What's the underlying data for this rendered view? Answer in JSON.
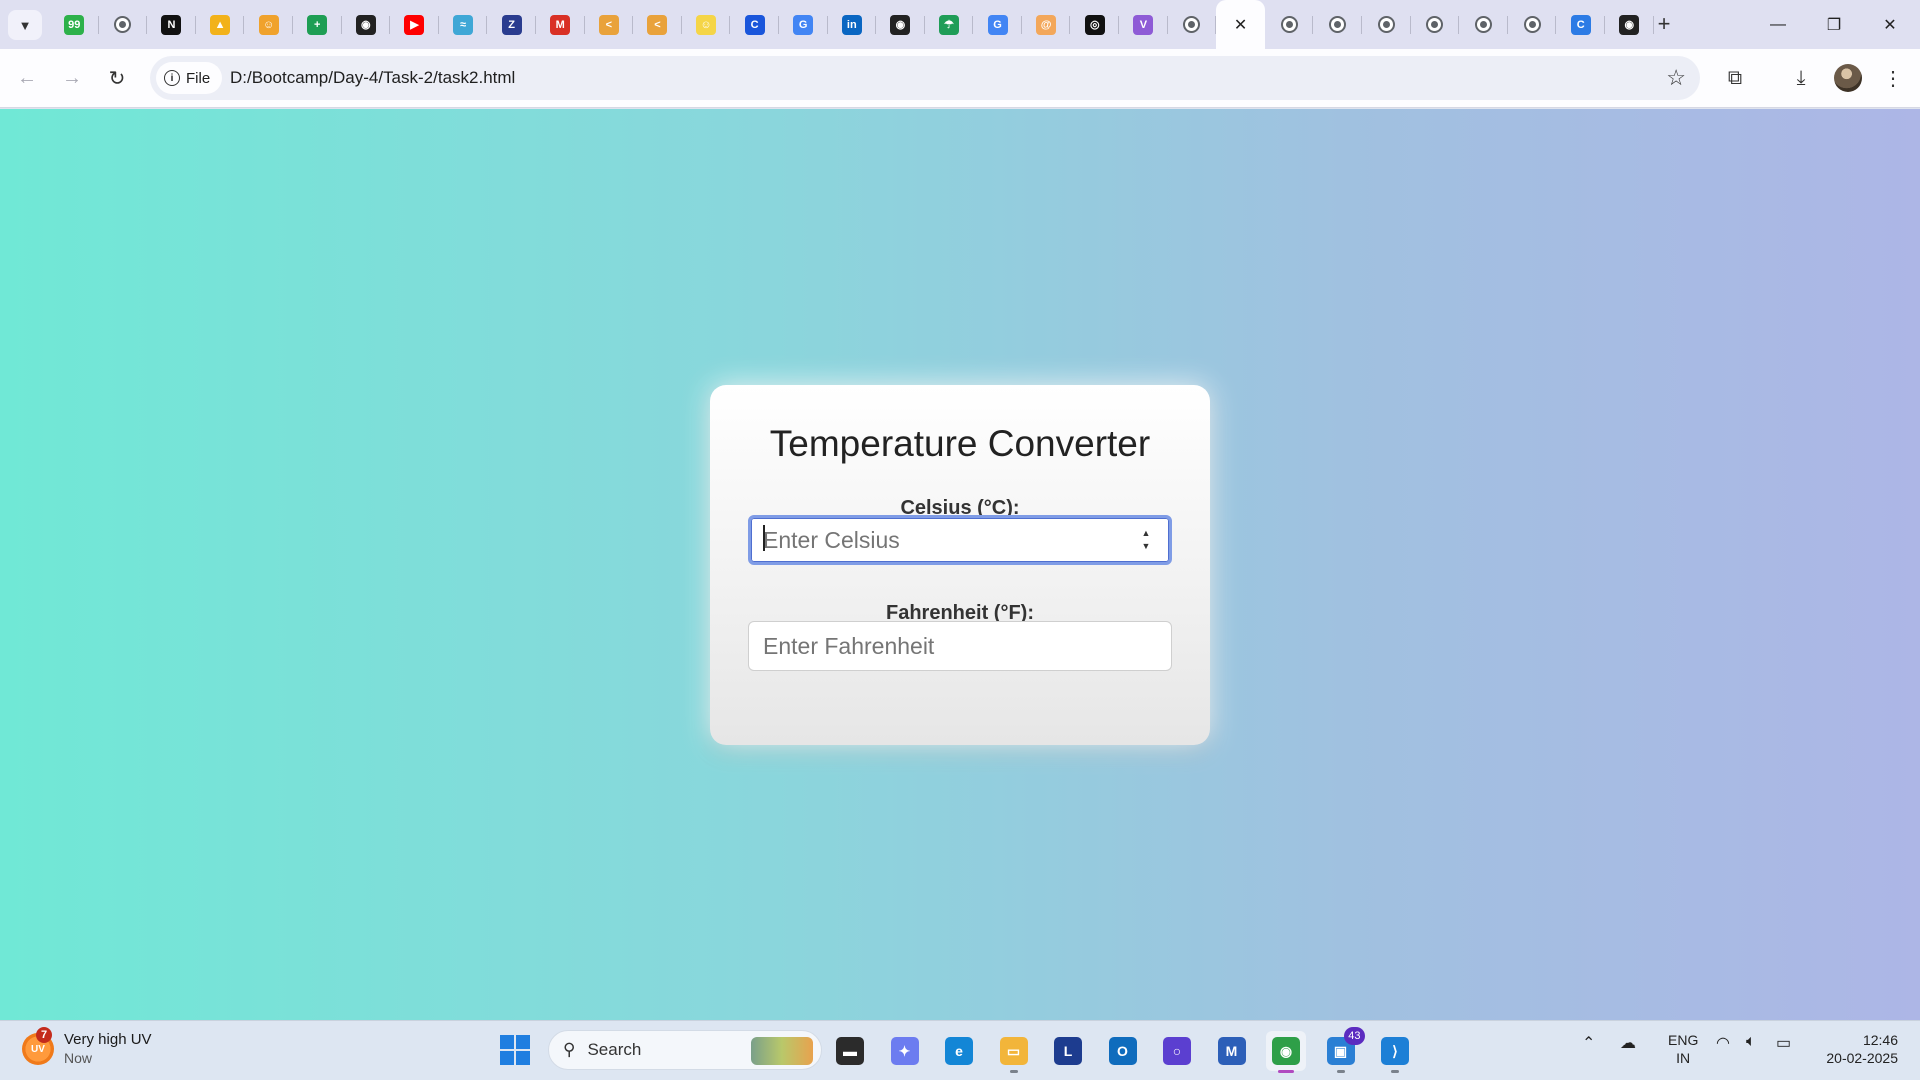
{
  "browser": {
    "pinned_tabs": [
      {
        "icon": "dollar-icon",
        "color": "#2db14a",
        "glyph": "99"
      },
      {
        "icon": "globe-icon",
        "color": "",
        "glyph": ""
      },
      {
        "icon": "notion-icon",
        "color": "#111111",
        "glyph": "N"
      },
      {
        "icon": "drive-icon",
        "color": "#f2b21a",
        "glyph": "▲"
      },
      {
        "icon": "emoji-icon",
        "color": "#f0a22c",
        "glyph": "☺"
      },
      {
        "icon": "sheets-icon",
        "color": "#1e9e54",
        "glyph": "+"
      },
      {
        "icon": "github-icon",
        "color": "#222222",
        "glyph": "◉"
      },
      {
        "icon": "youtube-icon",
        "color": "#ff0000",
        "glyph": "▶"
      },
      {
        "icon": "wave-icon",
        "color": "#3fa7d6",
        "glyph": "≈"
      },
      {
        "icon": "zeo-icon",
        "color": "#2a3c8f",
        "glyph": "Z"
      },
      {
        "icon": "gmail-icon",
        "color": "#d93025",
        "glyph": "M"
      },
      {
        "icon": "chevron-logo-icon",
        "color": "#e9a23b",
        "glyph": "<"
      },
      {
        "icon": "chevron-logo-icon",
        "color": "#e9a23b",
        "glyph": "<"
      },
      {
        "icon": "avatar-icon",
        "color": "#f5d547",
        "glyph": "☺"
      },
      {
        "icon": "c-logo-icon",
        "color": "#1a56db",
        "glyph": "C"
      },
      {
        "icon": "google-icon",
        "color": "#4285f4",
        "glyph": "G"
      },
      {
        "icon": "linkedin-icon",
        "color": "#0a66c2",
        "glyph": "in"
      },
      {
        "icon": "github-icon",
        "color": "#222222",
        "glyph": "◉"
      },
      {
        "icon": "umbrella-icon",
        "color": "#1f9d57",
        "glyph": "☂"
      },
      {
        "icon": "google-icon",
        "color": "#4285f4",
        "glyph": "G"
      },
      {
        "icon": "swirl-icon",
        "color": "#f3a75a",
        "glyph": "@"
      },
      {
        "icon": "openai-icon",
        "color": "#111111",
        "glyph": "◎"
      },
      {
        "icon": "vuetify-icon",
        "color": "#8e5bd6",
        "glyph": "V"
      },
      {
        "icon": "globe-icon",
        "color": "",
        "glyph": ""
      }
    ],
    "trailing_tabs": [
      {
        "icon": "globe-icon",
        "color": "",
        "glyph": ""
      },
      {
        "icon": "globe-icon",
        "color": "",
        "glyph": ""
      },
      {
        "icon": "globe-icon",
        "color": "",
        "glyph": ""
      },
      {
        "icon": "globe-icon",
        "color": "",
        "glyph": ""
      },
      {
        "icon": "globe-icon",
        "color": "",
        "glyph": ""
      },
      {
        "icon": "globe-icon",
        "color": "",
        "glyph": ""
      },
      {
        "icon": "copilot-icon",
        "color": "#2c7be5",
        "glyph": "C"
      },
      {
        "icon": "github-icon",
        "color": "#222222",
        "glyph": "◉"
      }
    ],
    "active_tab_close": "✕",
    "address": {
      "chip_label": "File",
      "url": "D:/Bootcamp/Day-4/Task-2/task2.html"
    }
  },
  "page": {
    "title": "Temperature Converter",
    "celsius": {
      "label": "Celsius (°C):",
      "placeholder": "Enter Celsius",
      "value": ""
    },
    "fahrenheit": {
      "label": "Fahrenheit (°F):",
      "placeholder": "Enter Fahrenheit",
      "value": ""
    },
    "colors": {
      "gradient_start": "#70e8d6",
      "gradient_end": "#adb6e6",
      "focus_ring": "#7f9ce6"
    }
  },
  "taskbar": {
    "weather": {
      "badge": "7",
      "icon_text": "UV",
      "title": "Very high UV",
      "subtitle": "Now"
    },
    "search_label": "Search",
    "apps": [
      {
        "name": "desktop-icon",
        "glyph": "▬",
        "color": "#2b2b2b"
      },
      {
        "name": "copilot-icon",
        "glyph": "✦",
        "color": "#6c7cf0"
      },
      {
        "name": "edge-icon",
        "glyph": "e",
        "color": "#1386d6"
      },
      {
        "name": "file-explorer-icon",
        "glyph": "▭",
        "color": "#f2b53a"
      },
      {
        "name": "l-app-icon",
        "glyph": "L",
        "color": "#1d3c8f"
      },
      {
        "name": "outlook-icon",
        "glyph": "O",
        "color": "#0f6cbd"
      },
      {
        "name": "cortana-icon",
        "glyph": "○",
        "color": "#5b3fd0"
      },
      {
        "name": "m365-icon",
        "glyph": "M",
        "color": "#2c5fb8"
      },
      {
        "name": "chrome-icon",
        "glyph": "◉",
        "color": "#2e9f48"
      },
      {
        "name": "remote-desktop-icon",
        "glyph": "▣",
        "color": "#2a7fd4"
      },
      {
        "name": "vscode-icon",
        "glyph": "⟩",
        "color": "#1c7fd6"
      }
    ],
    "remote_badge": "43",
    "lang_top": "ENG",
    "lang_bottom": "IN",
    "time": "12:46",
    "date": "20-02-2025"
  }
}
